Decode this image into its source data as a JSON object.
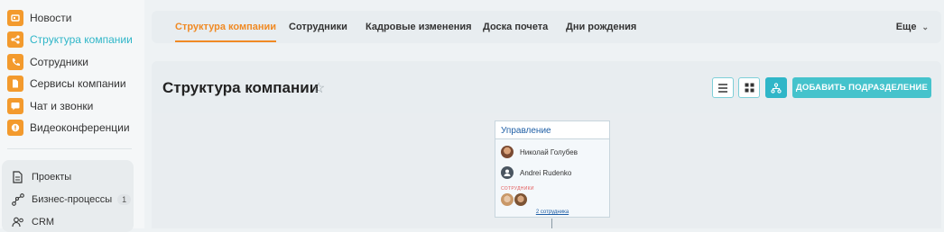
{
  "sidebar": {
    "menu": [
      {
        "label": "Новости",
        "icon": "news-icon",
        "active": false
      },
      {
        "label": "Структура компании",
        "icon": "structure-icon",
        "active": true
      },
      {
        "label": "Сотрудники",
        "icon": "phone-icon",
        "active": false
      },
      {
        "label": "Сервисы компании",
        "icon": "document-icon",
        "active": false
      },
      {
        "label": "Чат и звонки",
        "icon": "chat-icon",
        "active": false
      },
      {
        "label": "Видеоконференции",
        "icon": "video-icon",
        "active": false
      }
    ],
    "sub": [
      {
        "label": "Проекты",
        "icon": "projects-icon"
      },
      {
        "label": "Бизнес-процессы",
        "icon": "process-icon",
        "badge": "1"
      },
      {
        "label": "CRM",
        "icon": "crm-icon"
      }
    ]
  },
  "tabs": {
    "items": [
      "Структура компании",
      "Сотрудники",
      "Кадровые изменения",
      "Доска почета",
      "Дни рождения"
    ],
    "more": "Еще"
  },
  "header": {
    "title": "Структура компании",
    "add_button": "ДОБАВИТЬ ПОДРАЗДЕЛЕНИЕ"
  },
  "card": {
    "title": "Управление",
    "head_person": "Николай Голубев",
    "deputy": "Andrei Rudenko",
    "employees_label": "СОТРУДНИКИ",
    "employees_link": "2 сотрудника"
  },
  "colors": {
    "accent": "#f08a24",
    "teal": "#2fb6c8",
    "icon_orange": "#f39a2d",
    "link_blue": "#1f5fa6"
  }
}
